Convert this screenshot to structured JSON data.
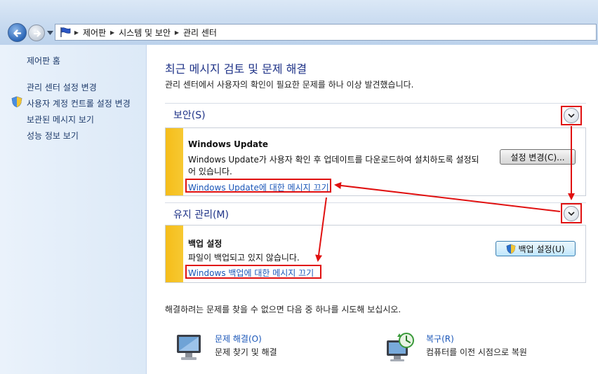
{
  "breadcrumb": [
    "제어판",
    "시스템 및 보안",
    "관리 센터"
  ],
  "sidebar": {
    "home": "제어판 홈",
    "items": [
      {
        "label": "관리 센터 설정 변경"
      },
      {
        "label": "사용자 계정 컨트롤 설정 변경",
        "icon": "uac-shield-icon"
      },
      {
        "label": "보관된 메시지 보기"
      },
      {
        "label": "성능 정보 보기"
      }
    ]
  },
  "main": {
    "title": "최근 메시지 검토 및 문제 해결",
    "subtitle": "관리 센터에서 사용자의 확인이 필요한 문제를 하나 이상 발견했습니다."
  },
  "security": {
    "header": "보안(S)",
    "card_title": "Windows Update",
    "card_desc_line1": "Windows Update가 사용자 확인 후 업데이트를 다운로드하여 설치하도록 설정되",
    "card_desc_line2": "어 있습니다.",
    "link": "Windows Update에 대한 메시지 끄기",
    "button": "설정 변경(C)..."
  },
  "maintenance": {
    "header": "유지 관리(M)",
    "card_title": "백업 설정",
    "card_desc": "파일이 백업되고 있지 않습니다.",
    "link": "Windows 백업에 대한 메시지 끄기",
    "button": "백업 설정(U)"
  },
  "footer": {
    "hint": "해결하려는 문제를 찾을 수 없으면 다음 중 하나를 시도해 보십시오.",
    "troubleshoot_link": "문제 해결(O)",
    "troubleshoot_desc": "문제 찾기 및 해결",
    "recovery_link": "복구(R)",
    "recovery_desc": "컴퓨터를 이전 시점으로 복원"
  },
  "colors": {
    "accent_title": "#1e3287",
    "link": "#1a56b8",
    "warning_stripe": "#f5bd1a",
    "annotation_red": "#e01010"
  }
}
